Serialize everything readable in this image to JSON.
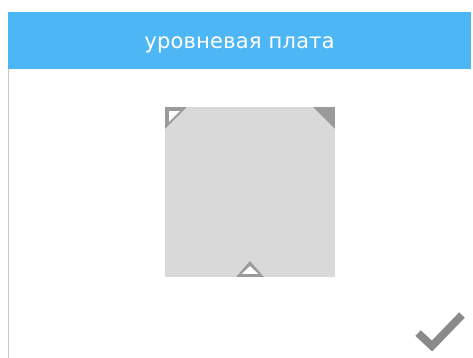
{
  "header": {
    "title": "уровневая плата"
  },
  "colors": {
    "header_bg": "#4db6f4",
    "bed": "#d9d9d9",
    "marker": "#9a9a9a",
    "checkmark": "#8a8a8a"
  },
  "icons": {
    "corner_top_left": "triangle-outline-icon",
    "corner_top_right": "triangle-filled-icon",
    "point_bottom_center": "triangle-outline-icon",
    "confirm": "checkmark-icon"
  }
}
